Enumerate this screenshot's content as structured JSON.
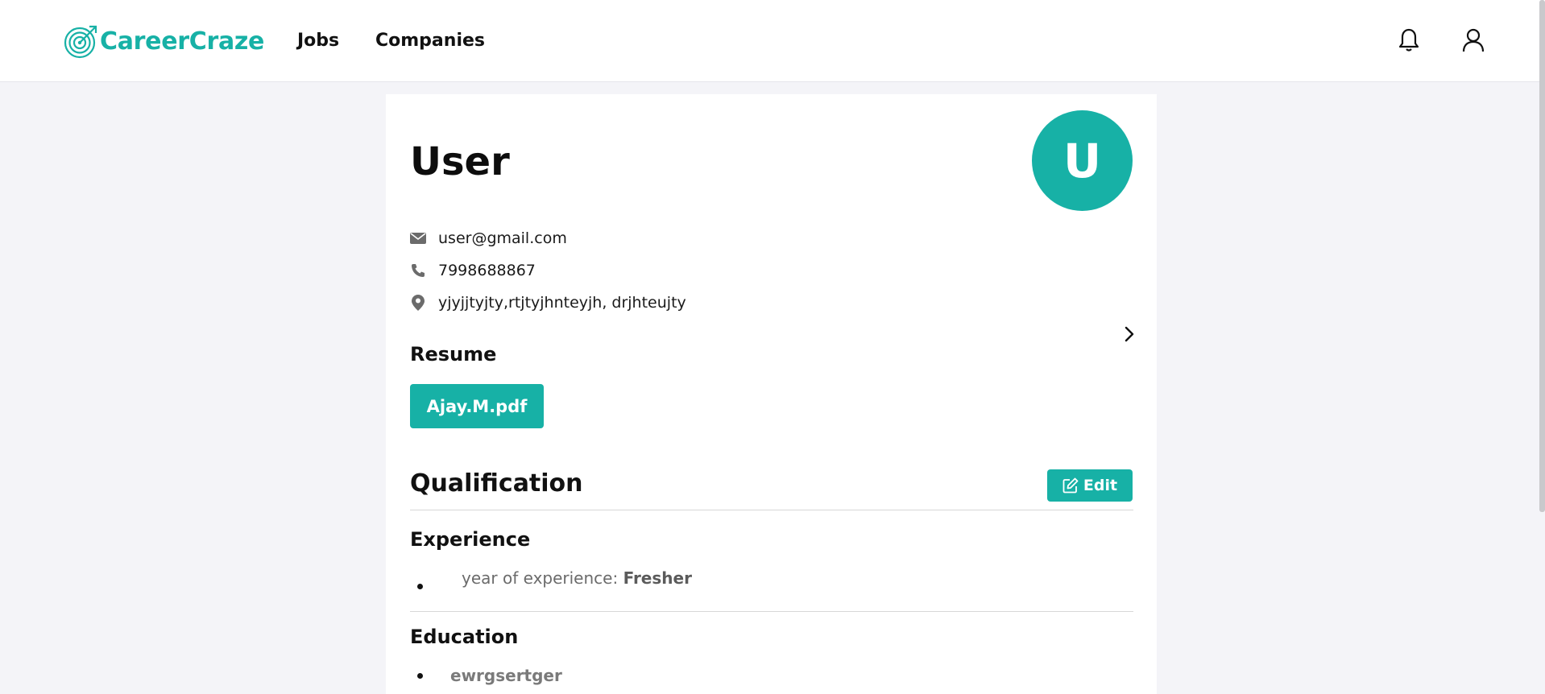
{
  "brand": {
    "name": "CareerCraze",
    "color": "#17b1a6"
  },
  "nav": {
    "jobs": "Jobs",
    "companies": "Companies"
  },
  "icons": {
    "notifications": "bell-icon",
    "account": "user-icon",
    "email": "envelope-icon",
    "phone": "phone-icon",
    "location": "map-pin-icon",
    "next": "chevron-right-icon",
    "edit": "pencil-square-icon"
  },
  "profile": {
    "name": "User",
    "avatar_letter": "U",
    "email": "user@gmail.com",
    "phone": "7998688867",
    "address": "yjyjjtyjty,rtjtyjhnteyjh, drjhteujty"
  },
  "resume": {
    "heading": "Resume",
    "file": "Ajay.M.pdf"
  },
  "qualification": {
    "heading": "Qualification",
    "edit_label": "Edit",
    "experience": {
      "heading": "Experience",
      "label": "year of experience: ",
      "value": "Fresher"
    },
    "education": {
      "heading": "Education",
      "items": [
        "ewrgsertger"
      ]
    }
  }
}
